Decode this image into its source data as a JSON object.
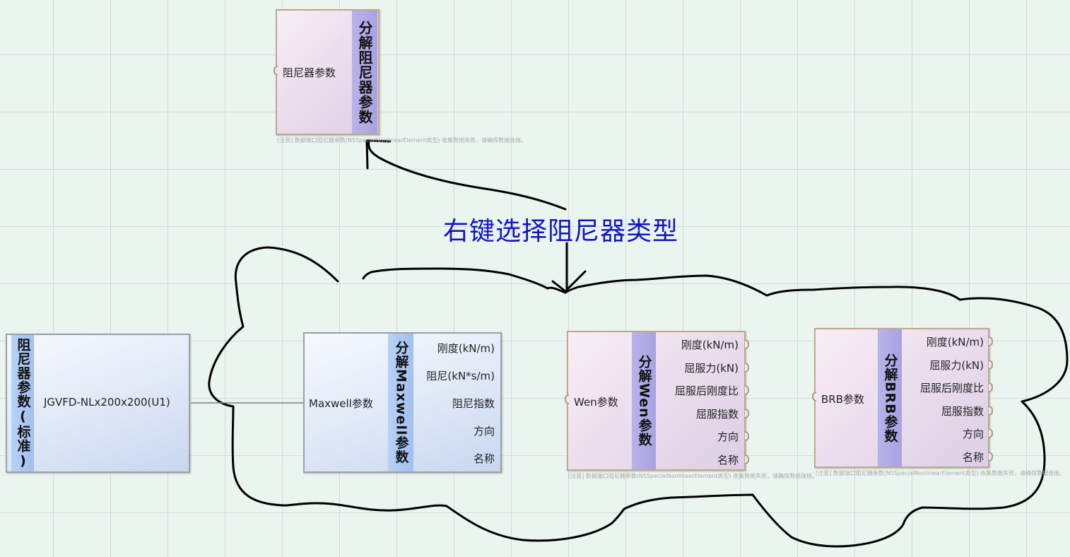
{
  "top_node": {
    "input_label": "阻尼器参数",
    "title": "分解阻尼器参数",
    "note": "[注意] 数据端口阻尼器参数(NSSpecialNonlinearElement类型) 收集数据失败，请确保数据连接。"
  },
  "hint_text": "右键选择阻尼器类型",
  "source_node": {
    "title": "阻尼器参数(标准)",
    "value": "JGVFD-NLx200x200(U1)"
  },
  "maxwell_node": {
    "input_label": "Maxwell参数",
    "title": "分解Maxwell参数",
    "ports": [
      "刚度(kN/m)",
      "阻尼(kN*s/m)",
      "阻尼指数",
      "方向",
      "名称"
    ]
  },
  "wen_node": {
    "input_label": "Wen参数",
    "title": "分解Wen参数",
    "ports": [
      "刚度(kN/m)",
      "屈服力(kN)",
      "屈服后刚度比",
      "屈服指数",
      "方向",
      "名称"
    ],
    "note": "[注意] 数据端口阻尼器参数(NSSpecialNonlinearElement类型) 收集数据失败，请确保数据连接。"
  },
  "brb_node": {
    "input_label": "BRB参数",
    "title": "分解BRB参数",
    "ports": [
      "刚度(kN/m)",
      "屈服力(kN)",
      "屈服后刚度比",
      "屈服指数",
      "方向",
      "名称"
    ],
    "note": "[注意] 数据端口阻尼器参数(NSSpecialNonlinearElement类型) 收集数据失败，请确保数据连接。"
  },
  "colors": {
    "hint": "#1212c8",
    "pink_border": "#c2a78a",
    "blue_border": "#9aa0a8",
    "purple_strip": "#aba5e4",
    "blue_strip": "#a8c4f1"
  }
}
